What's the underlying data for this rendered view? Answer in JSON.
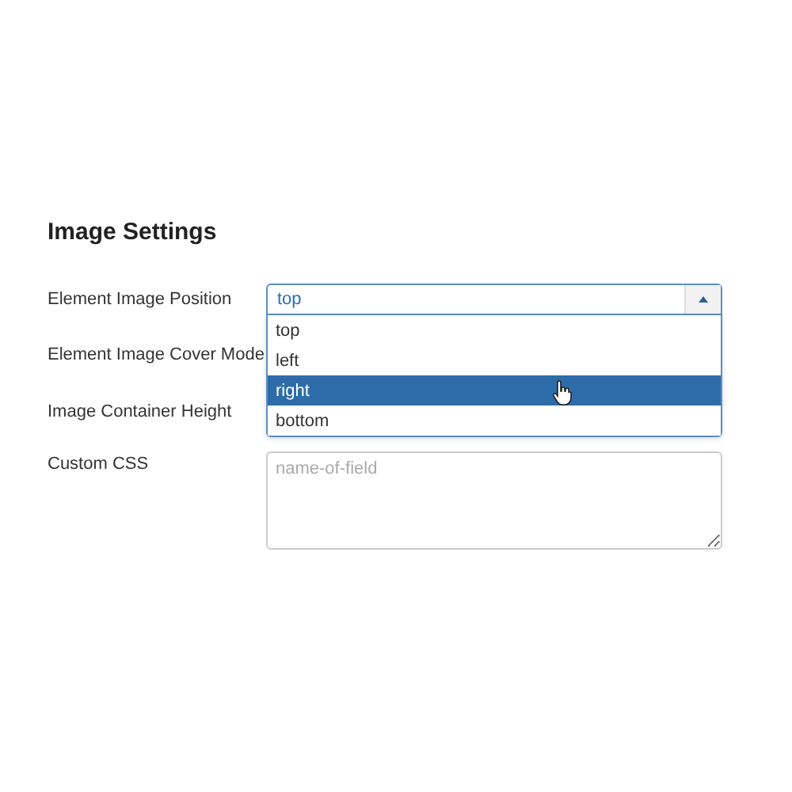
{
  "section": {
    "title": "Image Settings"
  },
  "fields": [
    {
      "kind": "select",
      "label": "Element Image Position",
      "value": "top",
      "expanded": true,
      "options": [
        {
          "label": "top",
          "highlighted": false
        },
        {
          "label": "left",
          "highlighted": false
        },
        {
          "label": "right",
          "highlighted": true
        },
        {
          "label": "bottom",
          "highlighted": false
        }
      ]
    },
    {
      "kind": "covered",
      "label": "Element Image Cover Mode"
    },
    {
      "kind": "covered",
      "label": "Image Container Height"
    },
    {
      "kind": "textarea",
      "label": "Custom CSS",
      "placeholder": "name-of-field"
    }
  ]
}
